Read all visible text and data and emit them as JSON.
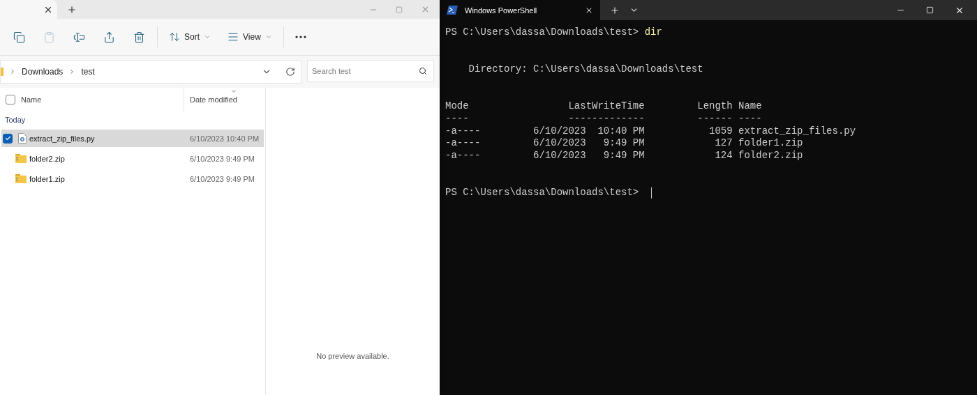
{
  "explorer": {
    "toolbar": [
      {
        "kind": "icon",
        "disabled": false
      },
      {
        "kind": "icon",
        "disabled": true
      },
      {
        "kind": "icon",
        "disabled": false
      },
      {
        "kind": "icon",
        "disabled": false
      },
      {
        "kind": "icon",
        "disabled": false
      },
      {
        "kind": "menu",
        "label": "Sort"
      },
      {
        "kind": "menu",
        "label": "View"
      },
      {
        "kind": "more"
      }
    ],
    "breadcrumb": [
      "Downloads",
      "test"
    ],
    "search": {
      "placeholder": "Search test"
    },
    "columns": [
      "Name",
      "Date modified"
    ],
    "all_checked": false,
    "group": "Today",
    "files": [
      {
        "name": "extract_zip_files.py",
        "kind": "script",
        "date": "6/10/2023 10:40 PM",
        "selected": true
      },
      {
        "name": "folder2.zip",
        "kind": "zip",
        "date": "6/10/2023 9:49 PM",
        "selected": false
      },
      {
        "name": "folder1.zip",
        "kind": "zip",
        "date": "6/10/2023 9:49 PM",
        "selected": false
      }
    ],
    "preview": "No preview available."
  },
  "terminal": {
    "tab": "Windows PowerShell",
    "blocks": [
      {
        "kind": "prompt",
        "prompt": "PS C:\\Users\\dassa\\Downloads\\test>",
        "command": "dir",
        "cursor": false
      },
      {
        "kind": "output",
        "lines": [
          "    Directory: C:\\Users\\dassa\\Downloads\\test"
        ]
      },
      {
        "kind": "output",
        "lines": [
          "Mode                 LastWriteTime         Length Name",
          "----                 -------------         ------ ----",
          "-a----         6/10/2023  10:40 PM           1059 extract_zip_files.py",
          "-a----         6/10/2023   9:49 PM            127 folder1.zip",
          "-a----         6/10/2023   9:49 PM            124 folder2.zip"
        ]
      },
      {
        "kind": "prompt",
        "prompt": "PS C:\\Users\\dassa\\Downloads\\test>",
        "cursor": true
      }
    ]
  }
}
